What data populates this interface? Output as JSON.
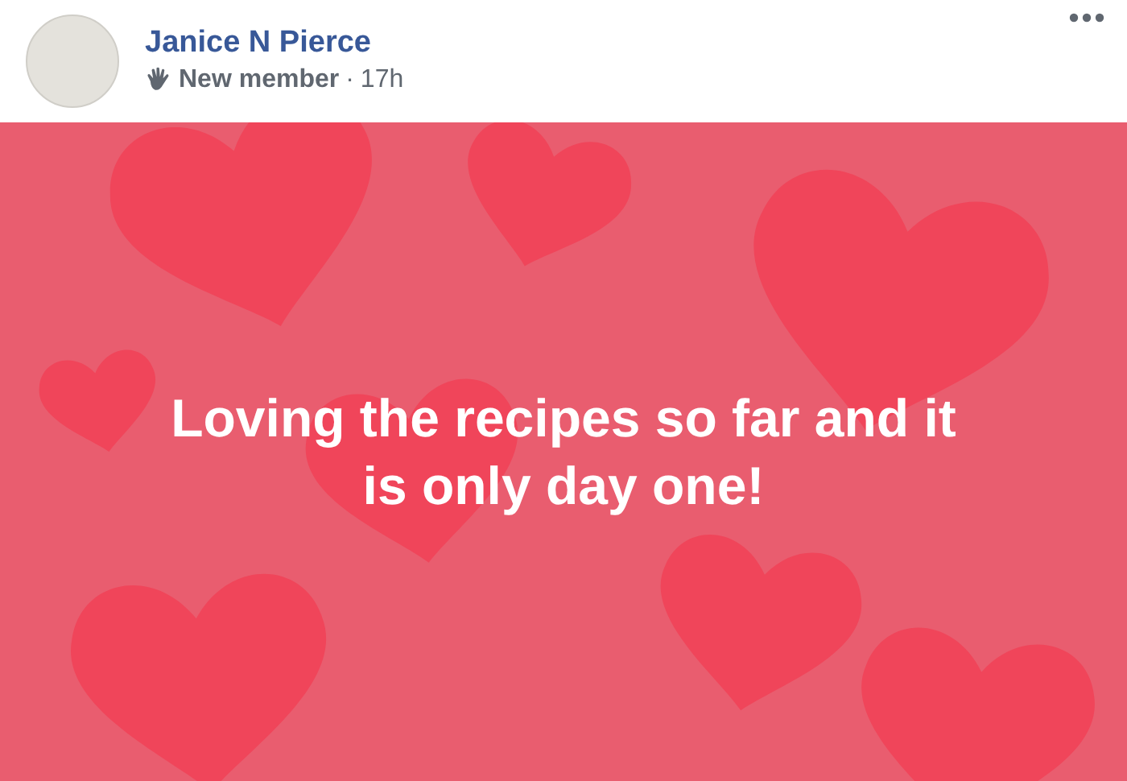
{
  "post": {
    "author": "Janice N Pierce",
    "badge": "New member",
    "separator": "·",
    "time": "17h",
    "text": "Loving the recipes so far and it is only day one!"
  }
}
